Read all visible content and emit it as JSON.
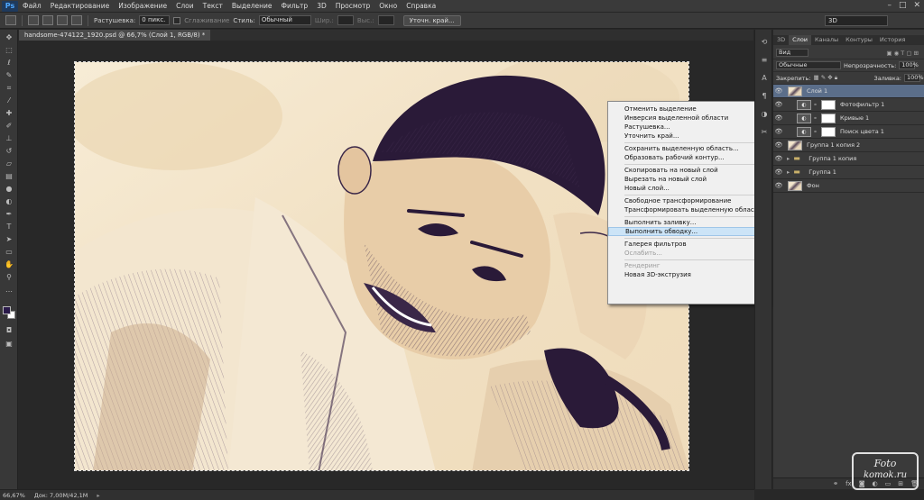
{
  "app": {
    "logo": "Ps"
  },
  "menu": [
    "Файл",
    "Редактирование",
    "Изображение",
    "Слои",
    "Текст",
    "Выделение",
    "Фильтр",
    "3D",
    "Просмотр",
    "Окно",
    "Справка"
  ],
  "window_controls": [
    "–",
    "□",
    "✕"
  ],
  "options": {
    "feather_label": "Растушевка:",
    "feather_value": "0 пикс.",
    "antialias_label": "Сглаживание",
    "style_label": "Стиль:",
    "style_value": "Обычный",
    "width_label": "Шир.:",
    "height_label": "Выс.:",
    "refine_button": "Уточн. край...",
    "workspace": "3D"
  },
  "document": {
    "tab": "handsome-474122_1920.psd @ 66,7% (Слой 1, RGB/8) *"
  },
  "status": {
    "zoom": "66,67%",
    "doc": "Док: 7,00M/42,1M"
  },
  "context_menu": {
    "items": [
      {
        "label": "Отменить выделение"
      },
      {
        "label": "Инверсия выделенной области"
      },
      {
        "label": "Растушевка..."
      },
      {
        "label": "Уточнить край..."
      },
      {
        "sep": true
      },
      {
        "label": "Сохранить выделенную область..."
      },
      {
        "label": "Образовать рабочий контур..."
      },
      {
        "sep": true
      },
      {
        "label": "Скопировать на новый слой"
      },
      {
        "label": "Вырезать на новый слой"
      },
      {
        "label": "Новый слой..."
      },
      {
        "sep": true
      },
      {
        "label": "Свободное трансформирование"
      },
      {
        "label": "Трансформировать выделенную область"
      },
      {
        "sep": true
      },
      {
        "label": "Выполнить заливку..."
      },
      {
        "label": "Выполнить обводку...",
        "highlighted": true
      },
      {
        "sep": true
      },
      {
        "label": "Галерея фильтров"
      },
      {
        "label": "Ослабить...",
        "disabled": true
      },
      {
        "sep": true
      },
      {
        "label": "Рендеринг",
        "disabled": true
      },
      {
        "label": "Новая 3D-экструзия"
      }
    ]
  },
  "layers_panel": {
    "tabs": [
      "3D",
      "Слои",
      "Каналы",
      "Контуры",
      "История"
    ],
    "active_tab": "Слои",
    "filter": "Вид",
    "blend_mode": "Обычные",
    "opacity_label": "Непрозрачность:",
    "opacity_value": "100%",
    "lock_label": "Закрепить:",
    "fill_label": "Заливка:",
    "fill_value": "100%",
    "layers": [
      {
        "name": "Слой 1",
        "thumb": "img",
        "selected": true,
        "indent": 0
      },
      {
        "name": "Фотофильтр 1",
        "thumb": "white",
        "indent": 1,
        "adj": true
      },
      {
        "name": "Кривые 1",
        "thumb": "white",
        "indent": 1,
        "adj": true
      },
      {
        "name": "Поиск цвета 1",
        "thumb": "white",
        "indent": 1,
        "adj": true
      },
      {
        "name": "Группа 1 копия 2",
        "thumb": "img",
        "indent": 0
      },
      {
        "name": "Группа 1 копия",
        "thumb": "folder",
        "indent": 0
      },
      {
        "name": "Группа 1",
        "thumb": "folder",
        "indent": 0
      },
      {
        "name": "Фон",
        "thumb": "img",
        "indent": 0
      }
    ]
  },
  "watermark": {
    "line1": "Foto",
    "line2": "komok.ru"
  },
  "colors": {
    "accent_selected_layer": "#5b6e8a",
    "foreground": "#2a1a4a",
    "background": "#ffffff"
  }
}
